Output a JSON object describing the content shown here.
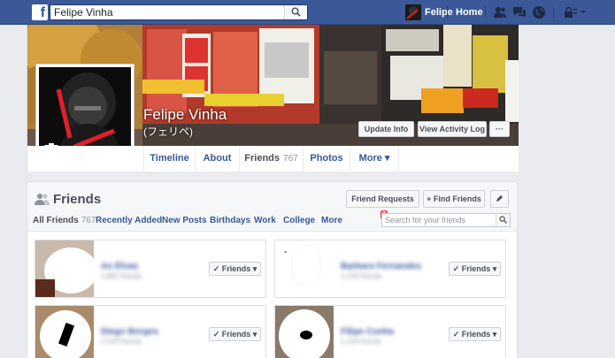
{
  "topbar": {
    "logo": "f",
    "search_value": "Felipe Vinha",
    "user_name": "Felipe",
    "home_label": "Home",
    "icons": [
      "friend-requests-icon",
      "messages-icon",
      "notifications-icon",
      "privacy-icon"
    ],
    "brand_color": "#3b5998"
  },
  "cover": {
    "name": "Felipe Vinha",
    "alt_name": "(フェリペ)",
    "update_info_label": "Update Info",
    "activity_log_label": "View Activity Log",
    "more_label": "···"
  },
  "tabs": [
    {
      "label": "Timeline"
    },
    {
      "label": "About"
    },
    {
      "label": "Friends",
      "count": "767"
    },
    {
      "label": "Photos"
    },
    {
      "label": "More ▾"
    }
  ],
  "friends": {
    "title": "Friends",
    "friend_requests_label": "Friend Requests",
    "friend_requests_count": "3",
    "find_friends_label": "+ Find Friends",
    "subtabs": [
      {
        "label": "All Friends",
        "count": "767"
      },
      {
        "label": "Recently Added"
      },
      {
        "label": "New Posts"
      },
      {
        "label": "Birthdays"
      },
      {
        "label": "Work"
      },
      {
        "label": "College"
      },
      {
        "label": "More"
      }
    ],
    "search_placeholder": "Search for your friends",
    "list": [
      {
        "name": "Ao Elvas",
        "sub": "1,882 friends",
        "button": "Friends"
      },
      {
        "name": "Barbara Fernandes",
        "sub": "1,234 friends",
        "button": "Friends"
      },
      {
        "name": "Diego Borges",
        "sub": "1,018 friends",
        "button": "Friends"
      },
      {
        "name": "Filipe Cunha",
        "sub": "1,416 friends",
        "button": "Friends"
      }
    ]
  }
}
